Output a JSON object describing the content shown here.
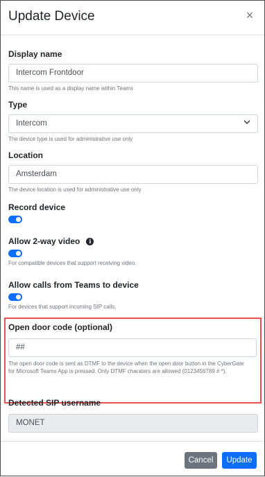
{
  "modal": {
    "title": "Update Device",
    "close_glyph": "×"
  },
  "fields": {
    "display_name": {
      "label": "Display name",
      "value": "Intercom Frontdoor",
      "hint": "This name is used as a display name within Teams"
    },
    "type": {
      "label": "Type",
      "value": "Intercom",
      "hint": "The device type is used for administrative use only"
    },
    "location": {
      "label": "Location",
      "value": "Amsterdam",
      "hint": "The device location is used for administrative use only"
    },
    "record_device": {
      "label": "Record device",
      "enabled": true
    },
    "allow_video": {
      "label": "Allow 2-way video",
      "info_icon": "info-icon",
      "enabled": true,
      "hint": "For compatible devices that support receiving video."
    },
    "allow_calls": {
      "label": "Allow calls from Teams to device",
      "enabled": true,
      "hint": "For devices that support incoming SIP calls."
    },
    "open_door_code": {
      "label": "Open door code (optional)",
      "value": "##",
      "hint": "The open door code is sent as DTMF to the device when the open door button in the CyberGate for Microsoft Teams App is pressed. Only DTMF charaters are allowed (0123456789 # *)."
    },
    "sip_username": {
      "label": "Detected SIP username",
      "value": "MONET"
    }
  },
  "footer": {
    "cancel_label": "Cancel",
    "update_label": "Update"
  },
  "colors": {
    "primary": "#0d6efd",
    "secondary": "#6c757d",
    "highlight_border": "#e8504f"
  }
}
